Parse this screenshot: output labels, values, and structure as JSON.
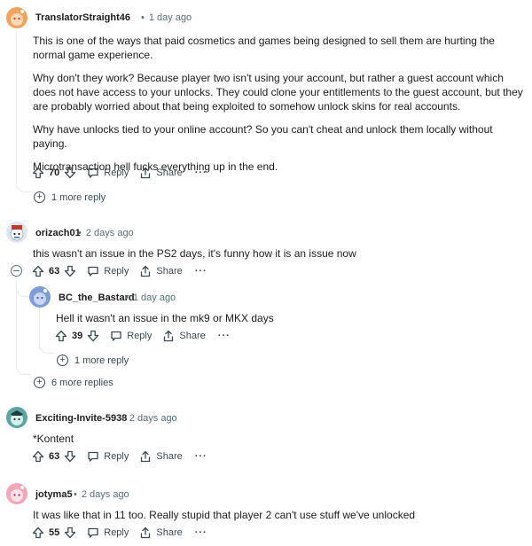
{
  "comments": [
    {
      "username": "TranslatorStraight46",
      "time": "1 day ago",
      "paragraphs": [
        "This is one of the ways that paid cosmetics and games being designed to sell them are hurting the normal game experience.",
        "Why don't they work? Because player two isn't using your account, but rather a guest account which does not have access to your unlocks. They could clone your entitlements to the guest account, but they are probably worried about that being exploited to somehow unlock skins for real accounts.",
        "Why have unlocks tied to your online account? So you can't cheat and unlock them locally without paying.",
        "Microtransaction hell fucks everything up in the end."
      ],
      "score": "70",
      "more_replies": "1 more reply"
    },
    {
      "username": "orizach01",
      "time": "2 days ago",
      "text": "this wasn't an issue in the PS2 days, it's funny how it is an issue now",
      "score": "63",
      "reply": {
        "username": "BC_the_Bastard",
        "time": "1 day ago",
        "text": "Hell it wasn't an issue in the mk9 or MKX days",
        "score": "39",
        "more_replies": "1 more reply"
      },
      "more_replies": "6 more replies"
    },
    {
      "username": "Exciting-Invite-5938",
      "time": "2 days ago",
      "text": "*Kontent",
      "score": "63"
    },
    {
      "username": "jotyma5",
      "time": "2 days ago",
      "text": "It was like that in 11 too. Really stupid that player 2 can't use stuff we've unlocked",
      "score": "55"
    }
  ],
  "labels": {
    "reply": "Reply",
    "share": "Share",
    "overflow": "···",
    "separator": "•"
  },
  "icons": {
    "upvote": "arrow-up-icon",
    "downvote": "arrow-down-icon",
    "reply": "speech-bubble-icon",
    "share": "share-icon",
    "more": "overflow-dots-icon",
    "expand": "plus-circle-icon",
    "collapse": "minus-circle-icon"
  },
  "colors": {
    "text": "#1c1c1c",
    "meta": "#576f76",
    "thread_line": "#e5ebee"
  }
}
